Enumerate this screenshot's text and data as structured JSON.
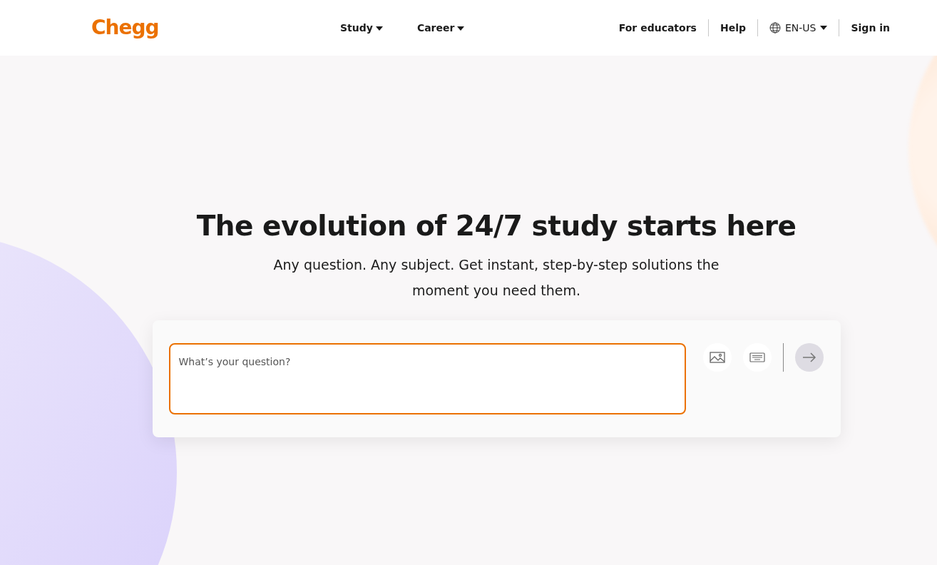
{
  "header": {
    "logo": "Chegg",
    "menus": [
      {
        "label": "Study"
      },
      {
        "label": "Career"
      }
    ],
    "links": [
      {
        "kind": "link",
        "label": "For educators"
      },
      {
        "kind": "link",
        "label": "Help"
      },
      {
        "kind": "language",
        "label": "EN-US"
      },
      {
        "kind": "link",
        "label": "Sign in"
      }
    ]
  },
  "hero": {
    "title": "The evolution of 24/7 study starts here",
    "subtitle": "Any question. Any subject. Get instant, step-by-step solutions the moment you need them."
  },
  "question_box": {
    "placeholder": "What’s your question?",
    "submit_disabled": true
  }
}
